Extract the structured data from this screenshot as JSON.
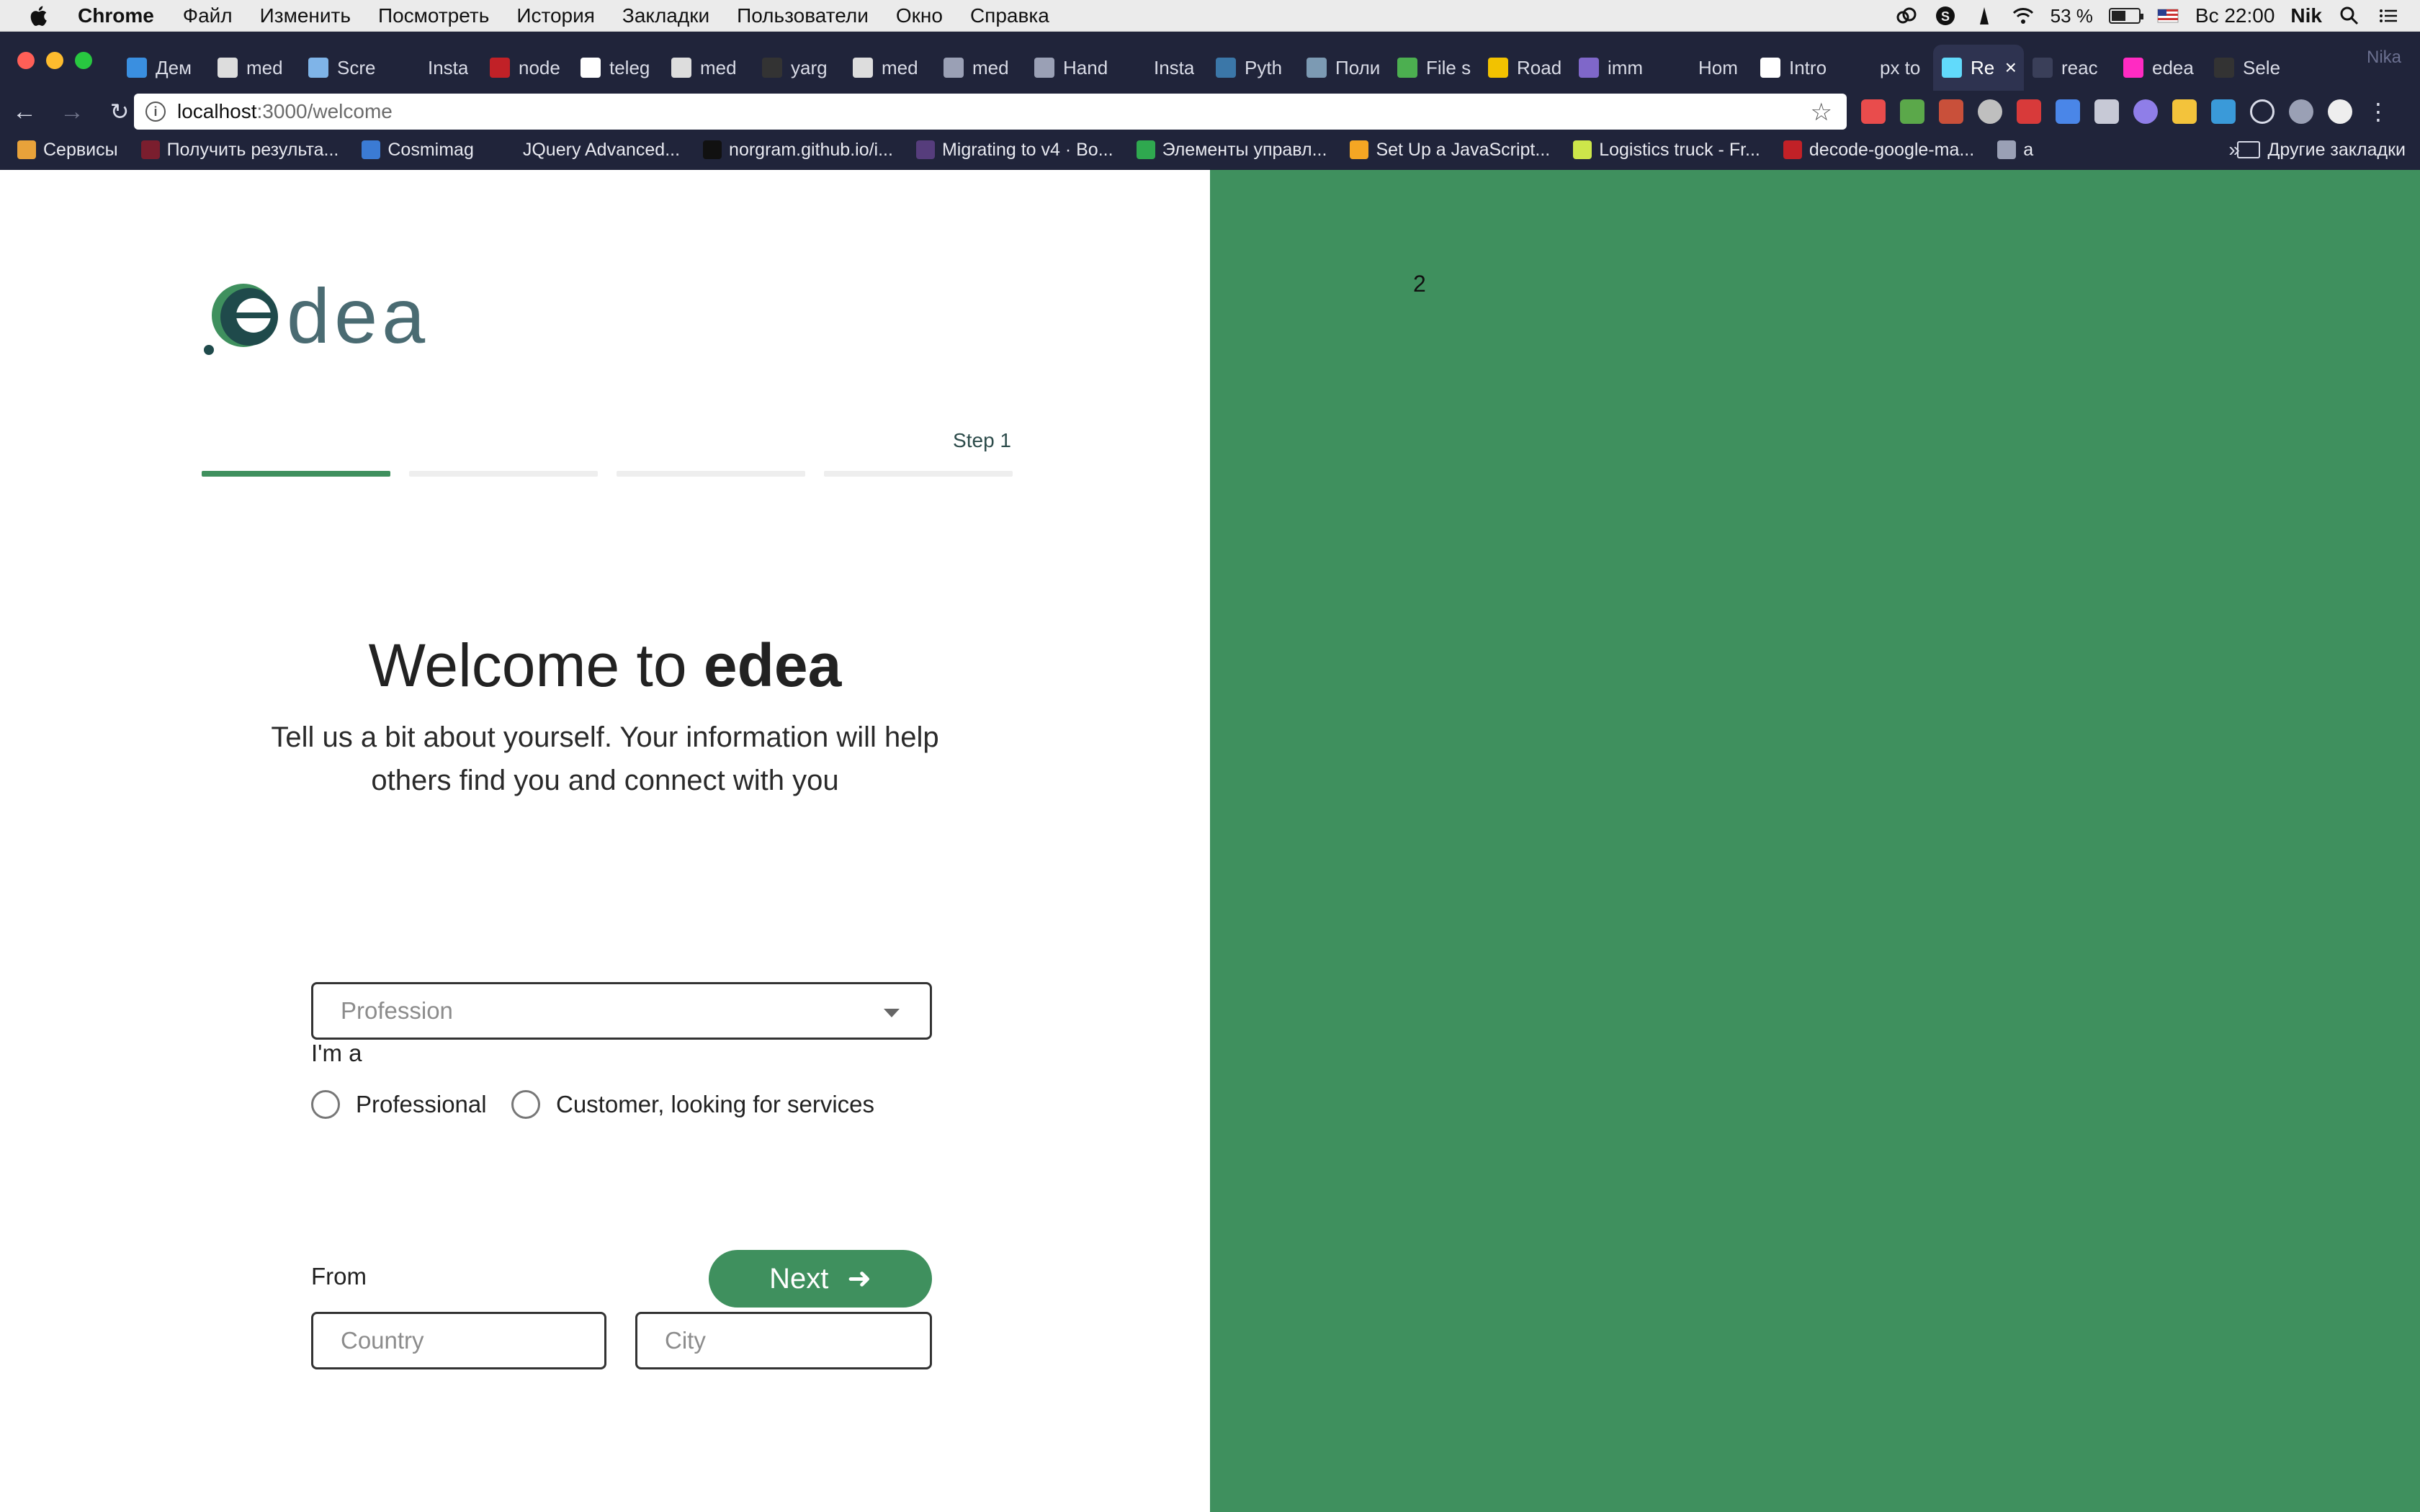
{
  "menubar": {
    "app_name": "Chrome",
    "items": [
      "Файл",
      "Изменить",
      "Посмотреть",
      "История",
      "Закладки",
      "Пользователи",
      "Окно",
      "Справка"
    ],
    "battery_text": "53 %",
    "battery_level": 0.53,
    "clock": "Вс 22:00",
    "user": "Nik"
  },
  "browser": {
    "tabs": [
      {
        "label": "Дем",
        "icon": "map-pin-icon",
        "color": "#3a8fe0"
      },
      {
        "label": "med",
        "icon": "medium-icon",
        "color": "#dddddd"
      },
      {
        "label": "Scre",
        "icon": "gear-icon",
        "color": "#7fb4e8"
      },
      {
        "label": "Insta",
        "icon": "page-icon",
        "color": "#20243a"
      },
      {
        "label": "node",
        "icon": "npm-icon",
        "color": "#c12127"
      },
      {
        "label": "teleg",
        "icon": "telegraph-icon",
        "color": "#ffffff"
      },
      {
        "label": "med",
        "icon": "medium-icon",
        "color": "#dddddd"
      },
      {
        "label": "yarg",
        "icon": "github-icon",
        "color": "#333333"
      },
      {
        "label": "med",
        "icon": "medium-icon",
        "color": "#dddddd"
      },
      {
        "label": "med",
        "icon": "image-icon",
        "color": "#9aa0b5"
      },
      {
        "label": "Hand",
        "icon": "link-icon",
        "color": "#9aa0b5"
      },
      {
        "label": "Insta",
        "icon": "cy-icon",
        "color": "#20243a"
      },
      {
        "label": "Pyth",
        "icon": "python-icon",
        "color": "#3b77a8"
      },
      {
        "label": "Поли",
        "icon": "habr-icon",
        "color": "#7c9ab3"
      },
      {
        "label": "File s",
        "icon": "cube-icon",
        "color": "#4caf50"
      },
      {
        "label": "Road",
        "icon": "circle-icon",
        "color": "#f2c200"
      },
      {
        "label": "imm",
        "icon": "heroku-icon",
        "color": "#7f67c9"
      },
      {
        "label": "Hom",
        "icon": "page-icon",
        "color": "#20243a"
      },
      {
        "label": "Intro",
        "icon": "arrow-icon",
        "color": "#ffffff"
      },
      {
        "label": "px to",
        "icon": "page-icon",
        "color": "#20243a"
      },
      {
        "label": "Re",
        "icon": "react-icon",
        "color": "#61dafb",
        "active": true
      },
      {
        "label": "reac",
        "icon": "react-icon",
        "color": "#3a3f59"
      },
      {
        "label": "edea",
        "icon": "xd-icon",
        "color": "#ff2bc2"
      },
      {
        "label": "Sele",
        "icon": "github-icon",
        "color": "#333333"
      }
    ],
    "profile": "Nika",
    "url_host": "localhost",
    "url_path": ":3000/welcome"
  },
  "bookmarks": {
    "items": [
      {
        "label": "Сервисы",
        "icon": "apps-grid-icon",
        "color": "#e8a23a"
      },
      {
        "label": "Получить результа...",
        "icon": "circle-icon",
        "color": "#7a1e2e"
      },
      {
        "label": "Cosmimag",
        "icon": "app-icon",
        "color": "#3b7bd4"
      },
      {
        "label": "JQuery Advanced...",
        "icon": "page-icon",
        "color": "#20243a"
      },
      {
        "label": "norgram.github.io/i...",
        "icon": "github-icon",
        "color": "#111111"
      },
      {
        "label": "Migrating to v4 · Bo...",
        "icon": "bootstrap-icon",
        "color": "#563d7c"
      },
      {
        "label": "Элементы управл...",
        "icon": "globe-icon",
        "color": "#2fa84f"
      },
      {
        "label": "Set Up a JavaScript...",
        "icon": "firebase-icon",
        "color": "#f5a623"
      },
      {
        "label": "Logistics truck - Fr...",
        "icon": "check-icon",
        "color": "#cde64a"
      },
      {
        "label": "decode-google-ma...",
        "icon": "npm-icon",
        "color": "#c12127"
      },
      {
        "label": "a",
        "icon": "bird-icon",
        "color": "#9aa0b5"
      }
    ],
    "more": "»",
    "other_label": "Другие закладки"
  },
  "page": {
    "step_label": "Step 1",
    "progress": {
      "current_step": 1,
      "total_steps": 4
    },
    "title_prefix": "Welcome to ",
    "title_brand": "edea",
    "subtitle": "Tell us a bit about yourself. Your information will help others find you and connect with you",
    "role_label": "I'm a",
    "role_options": [
      "Professional",
      "Customer, looking for services"
    ],
    "profession_placeholder": "Profession",
    "from_label": "From",
    "country_placeholder": "Country",
    "city_placeholder": "City",
    "next_label": "Next",
    "right_pane_number": "2"
  },
  "colors": {
    "brand_green": "#3f905e",
    "logo_dark": "#1f4a4b",
    "chrome_dark": "#20243a"
  }
}
